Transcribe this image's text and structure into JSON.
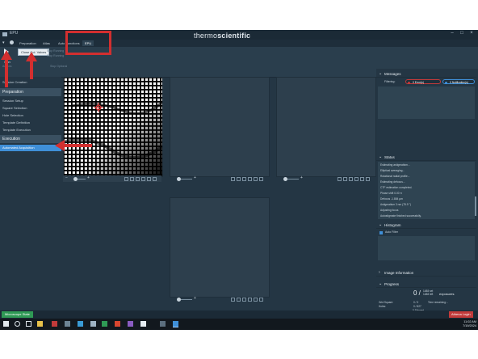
{
  "window": {
    "title": "EPU",
    "brand_left": "thermo",
    "brand_right": "scientific"
  },
  "menu_tabs": [
    "Preparation",
    "Atlas",
    "Auto Functions",
    "EPU"
  ],
  "ribbon": {
    "start_label_line1": "Start",
    "start_label_line2": "Run",
    "tooltip": "Close Col. Valves",
    "stop_label": "Stop Running",
    "stop_label2": "Stop Running",
    "stop_after_label": "Stop Optional",
    "sub_label": "Actions"
  },
  "left_nav": {
    "top_item": "Session Creation",
    "sections": [
      {
        "label": "Preparation",
        "items": [
          "Session Setup",
          "Square Selection",
          "Hole Selection",
          "Template Definition",
          "Template Execution"
        ]
      },
      {
        "label": "Execution",
        "items": [
          "Automated Acquisition"
        ]
      }
    ]
  },
  "right_panel": {
    "messages": {
      "title": "Messages",
      "filtering_label": "Filtering:",
      "errors": "0 Error(s)",
      "notifications": "0 Notification(s)"
    },
    "status": {
      "title": "Status",
      "lines": [
        "Estimating astigmatism...",
        "Elliptical averaging...",
        "Rotational radial profile...",
        "Estimating defocus...",
        "CTF estimation completed.",
        "Phase shift 0.00 π",
        "Defocus -1.884 µm",
        "Astigmatism 3 nm (75.9 °)",
        "Adjusting focus",
        "Autostigmate finished successfully."
      ]
    },
    "histogram": {
      "title": "Histogram",
      "checkbox_label": "Auto Filter"
    },
    "image_information": {
      "title": "Image Information"
    },
    "progress": {
      "title": "Progress",
      "count": "0 /",
      "count_top": "1488",
      "count_bottom": "1488",
      "count_top_suffix": "set",
      "count_bottom_suffix": "left",
      "exposures_label": "exposures",
      "grid_square_label": "Grid Square:",
      "grid_square_value": "0 / 3",
      "holes_label": "Holes:",
      "holes_value": "0 / 827",
      "skipped_value": "5 Skipped",
      "time_remaining": "Time remaining: -",
      "exposure_rate": "Exposure rate:"
    }
  },
  "status_bar": {
    "microscope_state": "Microscope State",
    "athena_login": "Athena Login"
  },
  "taskbar": {
    "time": "11:02 AM",
    "date": "7/19/2024"
  },
  "colors": {
    "accent": "#3f8fd8",
    "annotation": "#d32f2f",
    "app_bg": "#243644",
    "ok_green": "#2f9a55"
  }
}
